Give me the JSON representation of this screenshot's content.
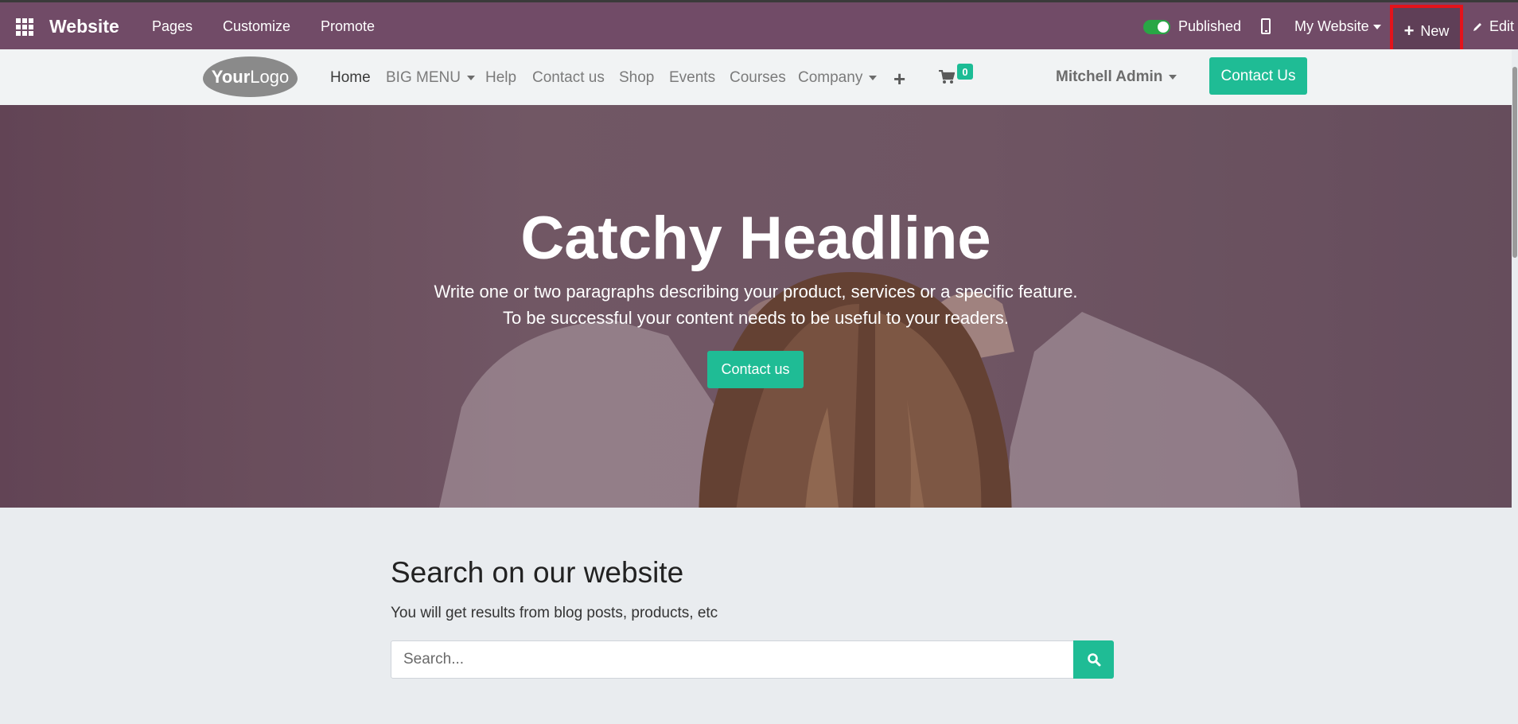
{
  "odoo_bar": {
    "brand": "Website",
    "menu": [
      "Pages",
      "Customize",
      "Promote"
    ],
    "published_label": "Published",
    "website_selector": "My Website",
    "new_label": "New",
    "edit_label": "Edit"
  },
  "site_header": {
    "logo_bold": "Your",
    "logo_rest": "Logo",
    "nav": {
      "home": "Home",
      "big_menu": "BIG MENU",
      "help": "Help",
      "contact_us": "Contact us",
      "shop": "Shop",
      "events": "Events",
      "courses": "Courses",
      "company": "Company"
    },
    "cart_count": "0",
    "user": "Mitchell Admin",
    "contact_button": "Contact Us"
  },
  "hero": {
    "title": "Catchy Headline",
    "line1": "Write one or two paragraphs describing your product, services or a specific feature.",
    "line2": "To be successful your content needs to be useful to your readers.",
    "button": "Contact us"
  },
  "search_section": {
    "title": "Search on our website",
    "subtitle": "You will get results from blog posts, products, etc",
    "placeholder": "Search..."
  },
  "colors": {
    "odoo_bar": "#714b67",
    "accent": "#1fbc95",
    "highlight_border": "#e3131b"
  }
}
